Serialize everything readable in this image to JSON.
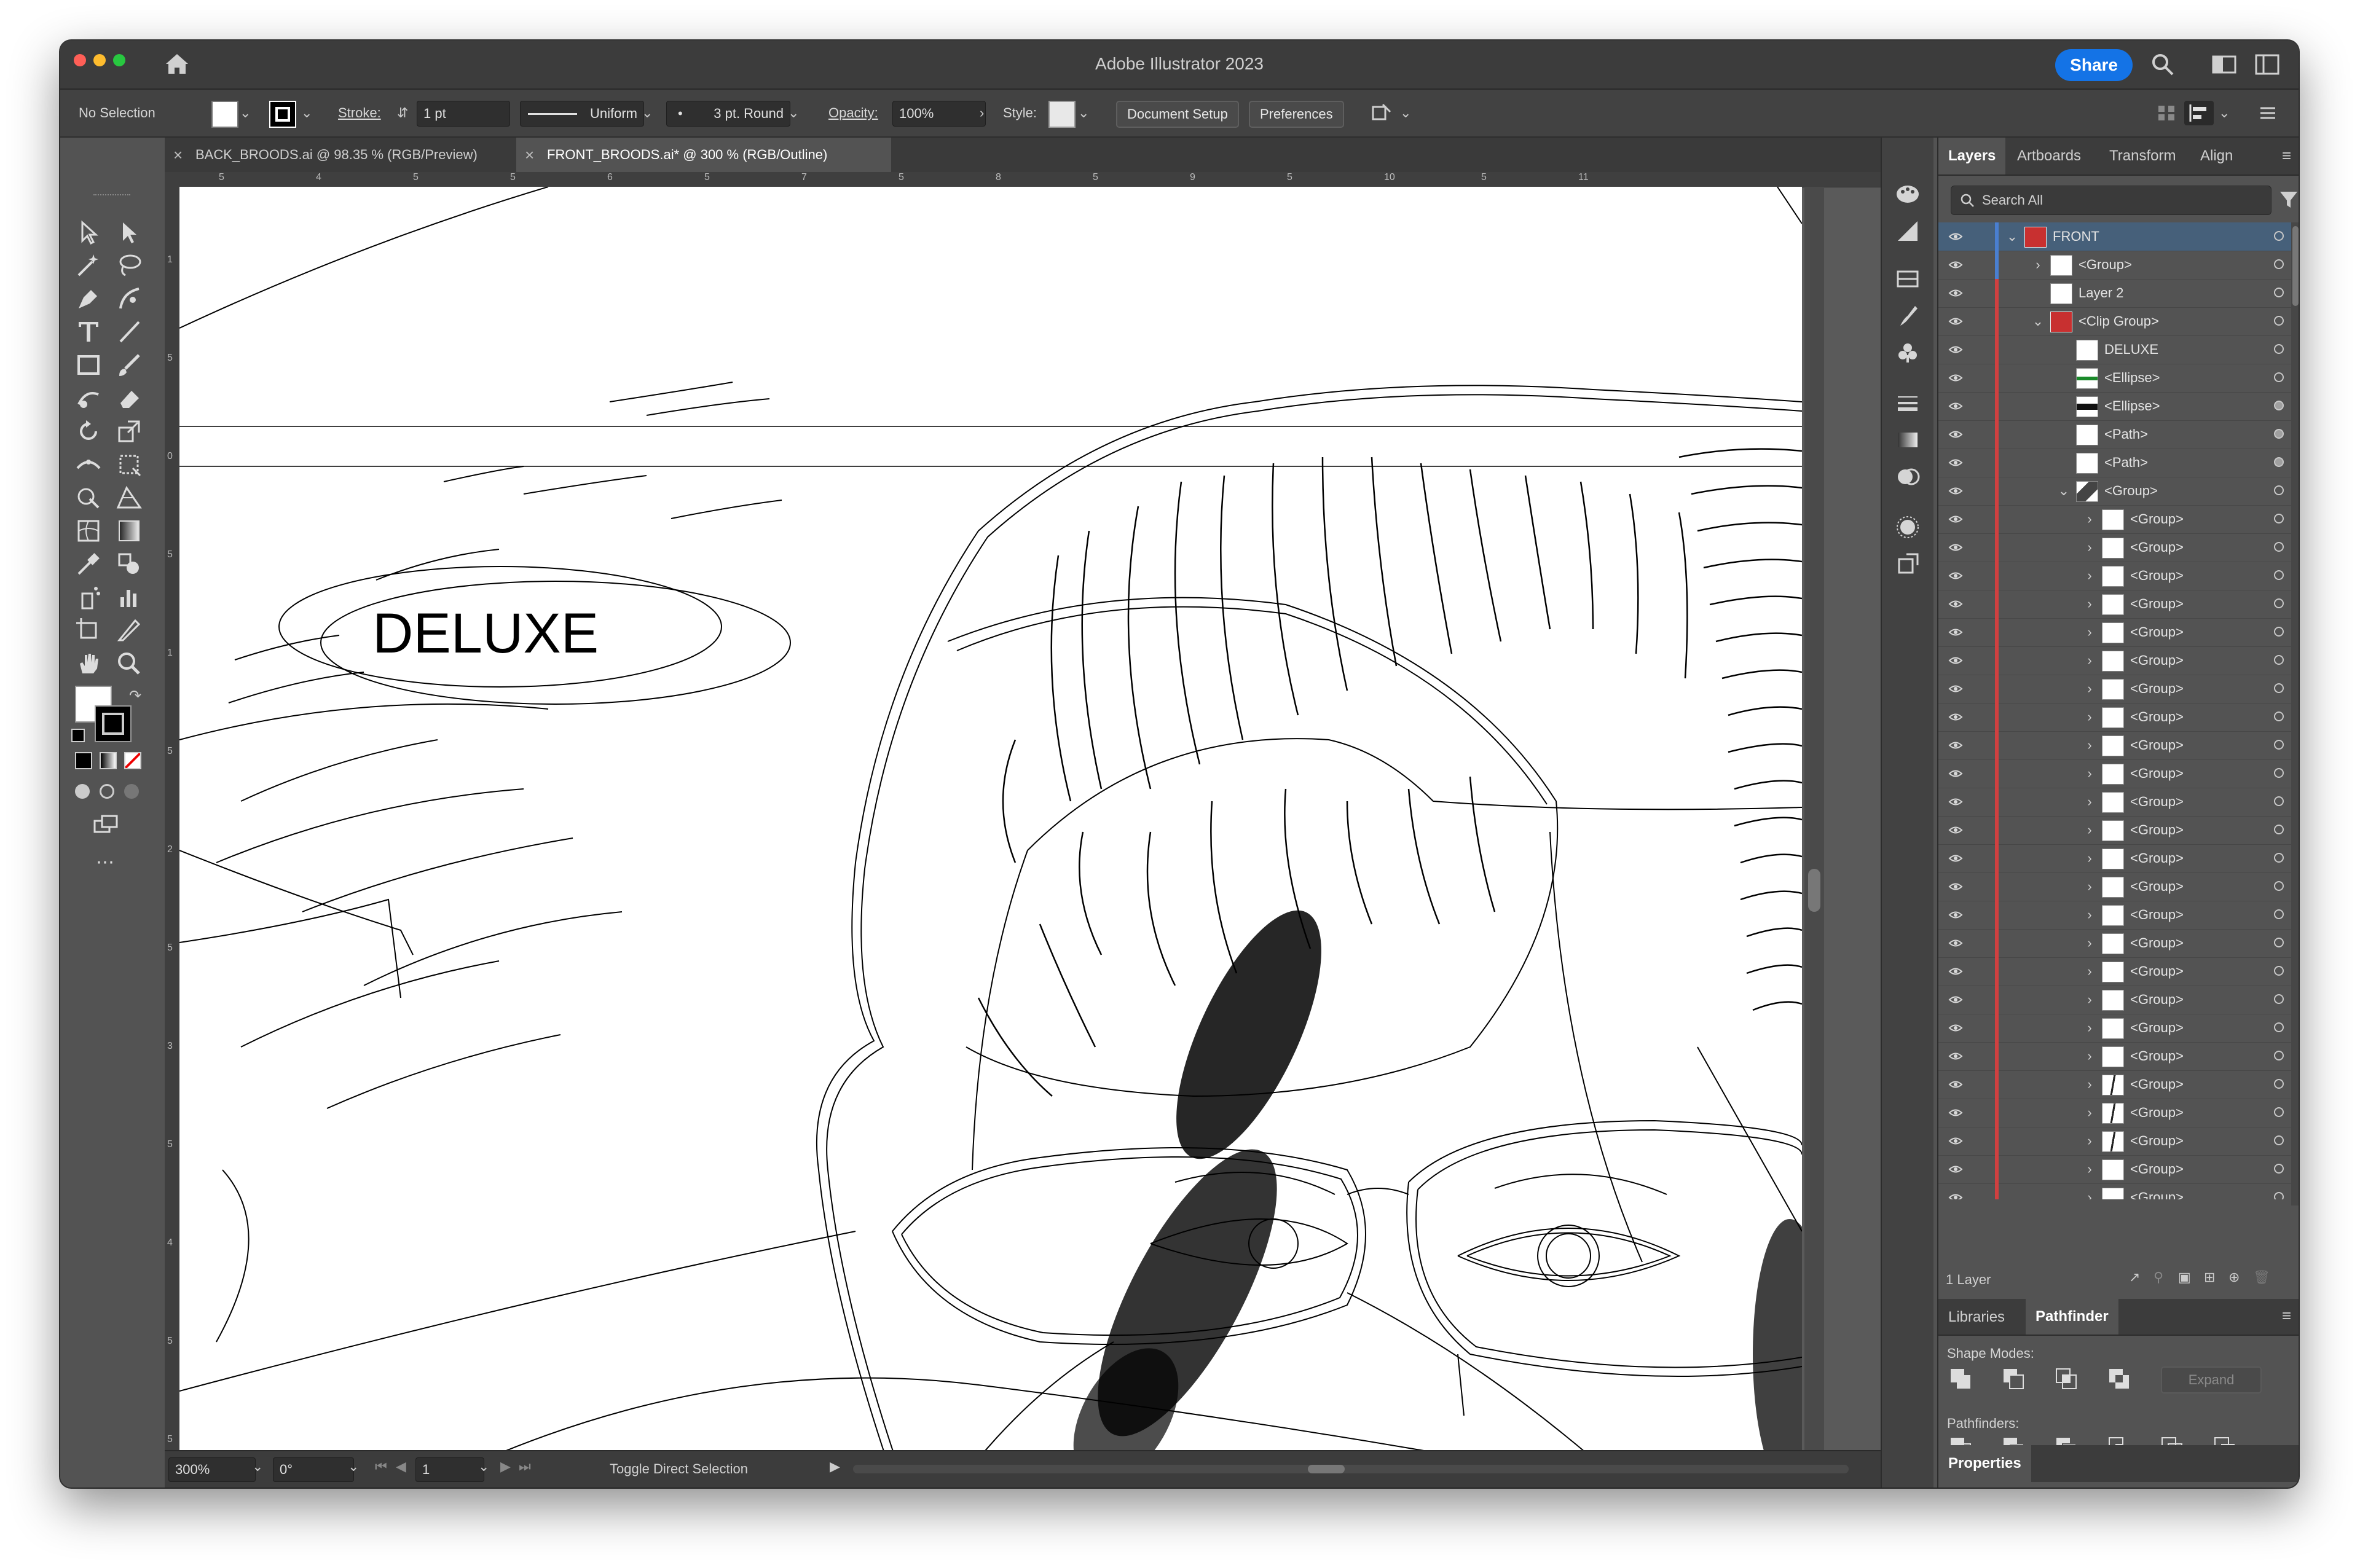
{
  "app": {
    "title": "Adobe Illustrator 2023",
    "share_label": "Share"
  },
  "control": {
    "selection": "No Selection",
    "stroke_label": "Stroke:",
    "stroke_value": "1 pt",
    "profile": "Uniform",
    "brush": "3 pt. Round",
    "opacity_label": "Opacity:",
    "opacity_value": "100%",
    "style_label": "Style:",
    "doc_setup": "Document Setup",
    "preferences": "Preferences"
  },
  "tabs": [
    {
      "label": "BACK_BROODS.ai @ 98.35 % (RGB/Preview)"
    },
    {
      "label": "FRONT_BROODS.ai* @ 300 % (RGB/Outline)"
    }
  ],
  "ruler": {
    "top": [
      "5",
      "4",
      "5",
      "5",
      "6",
      "5",
      "7",
      "5",
      "8",
      "5",
      "9",
      "5",
      "10",
      "5",
      "11"
    ],
    "left": [
      "1",
      "5",
      "0",
      "5",
      "1",
      "5",
      "2",
      "5",
      "3",
      "5",
      "4",
      "5",
      "5"
    ]
  },
  "artwork": {
    "text": "DELUXE"
  },
  "status": {
    "zoom": "300%",
    "rotation": "0°",
    "artboard": "1",
    "tool": "Toggle Direct Selection"
  },
  "layers_panel": {
    "tabs": [
      "Layers",
      "Artboards",
      "Transform",
      "Align"
    ],
    "search_placeholder": "Search All",
    "rows": [
      {
        "name": "FRONT",
        "indent": 0,
        "twirl": "v",
        "thumb": "red",
        "selected": true,
        "bar": "#4a7fd0",
        "target": "open"
      },
      {
        "name": "<Group>",
        "indent": 1,
        "twirl": ">",
        "thumb": "white",
        "bar": "#4a7fd0",
        "target": "open"
      },
      {
        "name": "Layer 2",
        "indent": 1,
        "twirl": "",
        "thumb": "white",
        "bar": "#d04040",
        "target": "open"
      },
      {
        "name": "<Clip Group>",
        "indent": 1,
        "twirl": "v",
        "thumb": "red",
        "bar": "#d04040",
        "target": "open"
      },
      {
        "name": "DELUXE",
        "indent": 2,
        "twirl": "",
        "thumb": "white",
        "bar": "#d04040",
        "target": "open"
      },
      {
        "name": "<Ellipse>",
        "indent": 2,
        "twirl": "",
        "thumb": "green",
        "bar": "#d04040",
        "target": "open"
      },
      {
        "name": "<Ellipse>",
        "indent": 2,
        "twirl": "",
        "thumb": "dark",
        "bar": "#d04040",
        "target": "filled"
      },
      {
        "name": "<Path>",
        "indent": 2,
        "twirl": "",
        "thumb": "white",
        "bar": "#d04040",
        "target": "filled"
      },
      {
        "name": "<Path>",
        "indent": 2,
        "twirl": "",
        "thumb": "white",
        "bar": "#d04040",
        "target": "filled"
      },
      {
        "name": "<Group>",
        "indent": 2,
        "twirl": "v",
        "thumb": "art",
        "bar": "#d04040",
        "target": "open"
      },
      {
        "name": "<Group>",
        "indent": 3,
        "twirl": ">",
        "thumb": "white",
        "bar": "#d04040",
        "target": "open"
      },
      {
        "name": "<Group>",
        "indent": 3,
        "twirl": ">",
        "thumb": "white",
        "bar": "#d04040",
        "target": "open"
      },
      {
        "name": "<Group>",
        "indent": 3,
        "twirl": ">",
        "thumb": "white",
        "bar": "#d04040",
        "target": "open"
      },
      {
        "name": "<Group>",
        "indent": 3,
        "twirl": ">",
        "thumb": "white",
        "bar": "#d04040",
        "target": "open"
      },
      {
        "name": "<Group>",
        "indent": 3,
        "twirl": ">",
        "thumb": "white",
        "bar": "#d04040",
        "target": "open"
      },
      {
        "name": "<Group>",
        "indent": 3,
        "twirl": ">",
        "thumb": "white",
        "bar": "#d04040",
        "target": "open"
      },
      {
        "name": "<Group>",
        "indent": 3,
        "twirl": ">",
        "thumb": "white",
        "bar": "#d04040",
        "target": "open"
      },
      {
        "name": "<Group>",
        "indent": 3,
        "twirl": ">",
        "thumb": "white",
        "bar": "#d04040",
        "target": "open"
      },
      {
        "name": "<Group>",
        "indent": 3,
        "twirl": ">",
        "thumb": "white",
        "bar": "#d04040",
        "target": "open"
      },
      {
        "name": "<Group>",
        "indent": 3,
        "twirl": ">",
        "thumb": "white",
        "bar": "#d04040",
        "target": "open"
      },
      {
        "name": "<Group>",
        "indent": 3,
        "twirl": ">",
        "thumb": "white",
        "bar": "#d04040",
        "target": "open"
      },
      {
        "name": "<Group>",
        "indent": 3,
        "twirl": ">",
        "thumb": "white",
        "bar": "#d04040",
        "target": "open"
      },
      {
        "name": "<Group>",
        "indent": 3,
        "twirl": ">",
        "thumb": "white",
        "bar": "#d04040",
        "target": "open"
      },
      {
        "name": "<Group>",
        "indent": 3,
        "twirl": ">",
        "thumb": "white",
        "bar": "#d04040",
        "target": "open"
      },
      {
        "name": "<Group>",
        "indent": 3,
        "twirl": ">",
        "thumb": "white",
        "bar": "#d04040",
        "target": "open"
      },
      {
        "name": "<Group>",
        "indent": 3,
        "twirl": ">",
        "thumb": "white",
        "bar": "#d04040",
        "target": "open"
      },
      {
        "name": "<Group>",
        "indent": 3,
        "twirl": ">",
        "thumb": "white",
        "bar": "#d04040",
        "target": "open"
      },
      {
        "name": "<Group>",
        "indent": 3,
        "twirl": ">",
        "thumb": "white",
        "bar": "#d04040",
        "target": "open"
      },
      {
        "name": "<Group>",
        "indent": 3,
        "twirl": ">",
        "thumb": "white",
        "bar": "#d04040",
        "target": "open"
      },
      {
        "name": "<Group>",
        "indent": 3,
        "twirl": ">",
        "thumb": "white",
        "bar": "#d04040",
        "target": "open"
      },
      {
        "name": "<Group>",
        "indent": 3,
        "twirl": ">",
        "thumb": "line",
        "bar": "#d04040",
        "target": "open"
      },
      {
        "name": "<Group>",
        "indent": 3,
        "twirl": ">",
        "thumb": "line",
        "bar": "#d04040",
        "target": "open"
      },
      {
        "name": "<Group>",
        "indent": 3,
        "twirl": ">",
        "thumb": "line",
        "bar": "#d04040",
        "target": "open"
      },
      {
        "name": "<Group>",
        "indent": 3,
        "twirl": ">",
        "thumb": "white",
        "bar": "#d04040",
        "target": "open"
      },
      {
        "name": "<Group>",
        "indent": 3,
        "twirl": ">",
        "thumb": "white",
        "bar": "#d04040",
        "target": "open"
      }
    ],
    "footer": "1 Layer"
  },
  "pathfinder_panel": {
    "tabs": [
      "Libraries",
      "Pathfinder"
    ],
    "shape_modes_label": "Shape Modes:",
    "pathfinders_label": "Pathfinders:",
    "expand_label": "Expand"
  },
  "properties_tab": "Properties",
  "colors": {
    "accent": "#1473e6",
    "layer_blue": "#4a7fd0",
    "layer_red": "#d04040",
    "selected_row": "#46607a"
  }
}
